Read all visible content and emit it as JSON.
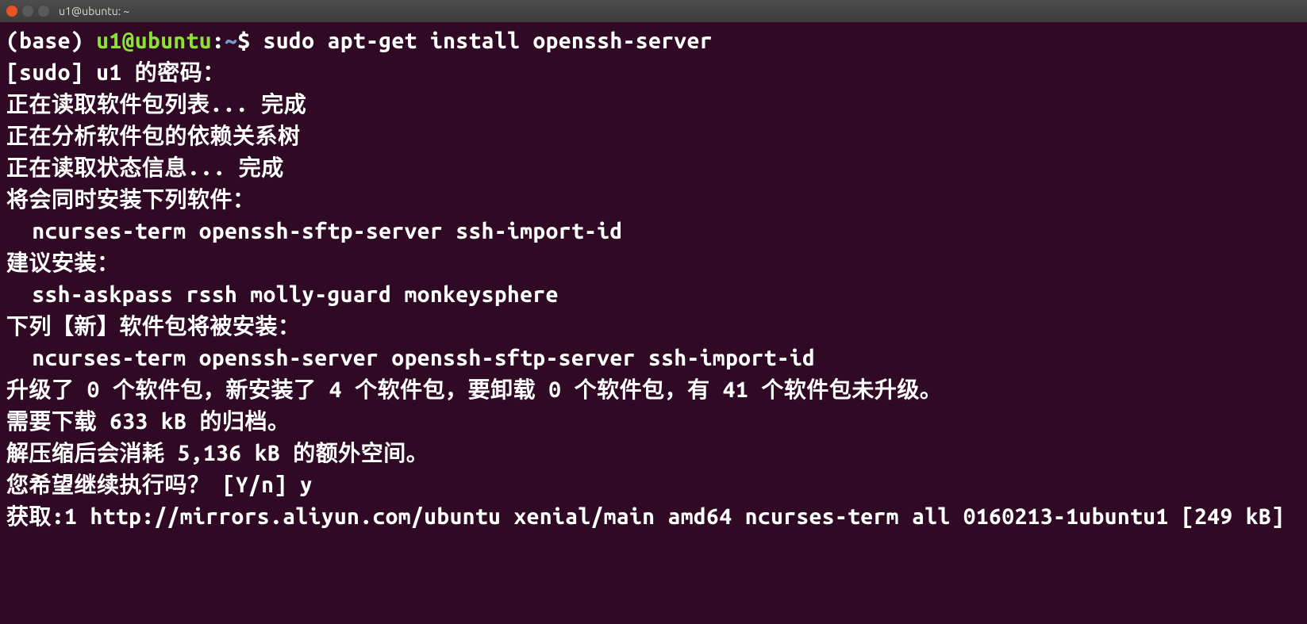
{
  "window": {
    "title": "u1@ubuntu: ~"
  },
  "prompt": {
    "base": "(base) ",
    "user": "u1",
    "at": "@",
    "host": "ubuntu",
    "colon": ":",
    "path": "~",
    "dollar": "$ "
  },
  "command": "sudo apt-get install openssh-server",
  "output": {
    "l1": "[sudo] u1 的密码：",
    "l2": "正在读取软件包列表... 完成",
    "l3": "正在分析软件包的依赖关系树",
    "l4": "正在读取状态信息... 完成",
    "l5": "将会同时安装下列软件：",
    "l6": "  ncurses-term openssh-sftp-server ssh-import-id",
    "l7": "建议安装：",
    "l8": "  ssh-askpass rssh molly-guard monkeysphere",
    "l9": "下列【新】软件包将被安装：",
    "l10": "  ncurses-term openssh-server openssh-sftp-server ssh-import-id",
    "l11": "升级了 0 个软件包，新安装了 4 个软件包，要卸载 0 个软件包，有 41 个软件包未升级。",
    "l12": "需要下载 633 kB 的归档。",
    "l13": "解压缩后会消耗 5,136 kB 的额外空间。",
    "l14": "您希望继续执行吗？ [Y/n] y",
    "l15": "获取:1 http://mirrors.aliyun.com/ubuntu xenial/main amd64 ncurses-term all 0160213-1ubuntu1 [249 kB]"
  }
}
